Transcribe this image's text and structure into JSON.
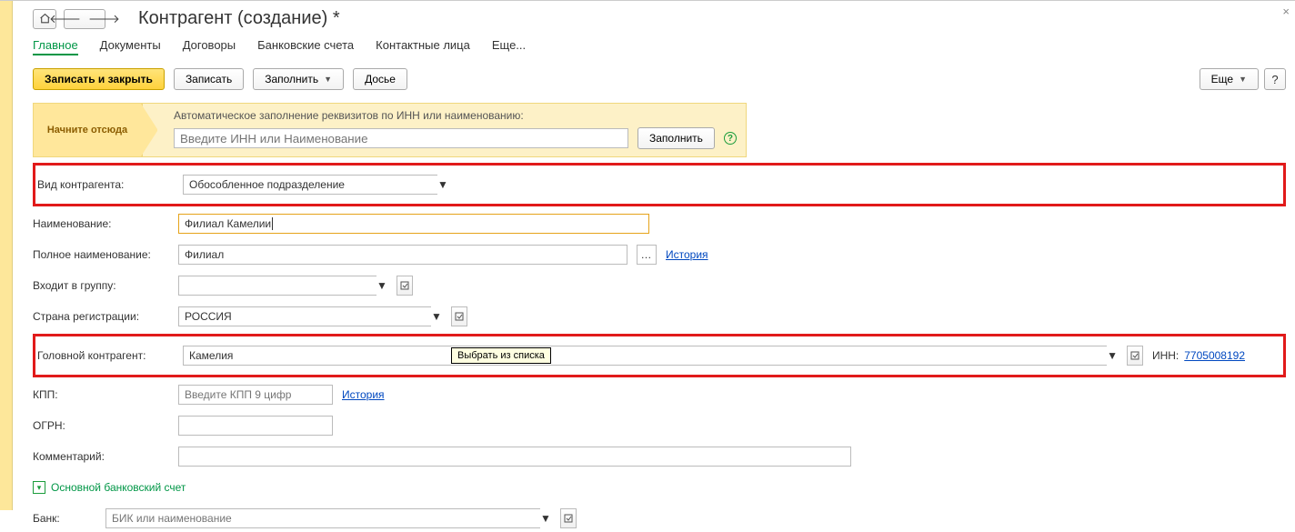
{
  "header": {
    "title": "Контрагент (создание) *"
  },
  "tabs": [
    {
      "label": "Главное",
      "active": true
    },
    {
      "label": "Документы"
    },
    {
      "label": "Договоры"
    },
    {
      "label": "Банковские счета"
    },
    {
      "label": "Контактные лица"
    },
    {
      "label": "Еще..."
    }
  ],
  "toolbar": {
    "save_close": "Записать и закрыть",
    "save": "Записать",
    "fill": "Заполнить",
    "dossier": "Досье",
    "more": "Еще"
  },
  "start_banner": {
    "label": "Начните отсюда",
    "caption": "Автоматическое заполнение реквизитов по ИНН или наименованию:",
    "placeholder": "Введите ИНН или Наименование",
    "fill": "Заполнить"
  },
  "form": {
    "type_label": "Вид контрагента:",
    "type_value": "Обособленное подразделение",
    "name_label": "Наименование:",
    "name_value": "Филиал Камелии",
    "fullname_label": "Полное наименование:",
    "fullname_value": "Филиал",
    "history": "История",
    "group_label": "Входит в группу:",
    "country_label": "Страна регистрации:",
    "country_value": "РОССИЯ",
    "parent_label": "Головной контрагент:",
    "parent_value": "Камелия",
    "parent_tooltip": "Выбрать из списка",
    "inn_label": "ИНН:",
    "inn_value": "7705008192",
    "kpp_label": "КПП:",
    "kpp_placeholder": "Введите КПП 9 цифр",
    "ogrn_label": "ОГРН:",
    "comment_label": "Комментарий:",
    "bank_section": "Основной банковский счет",
    "bank_label": "Банк:",
    "bank_placeholder": "БИК или наименование"
  }
}
